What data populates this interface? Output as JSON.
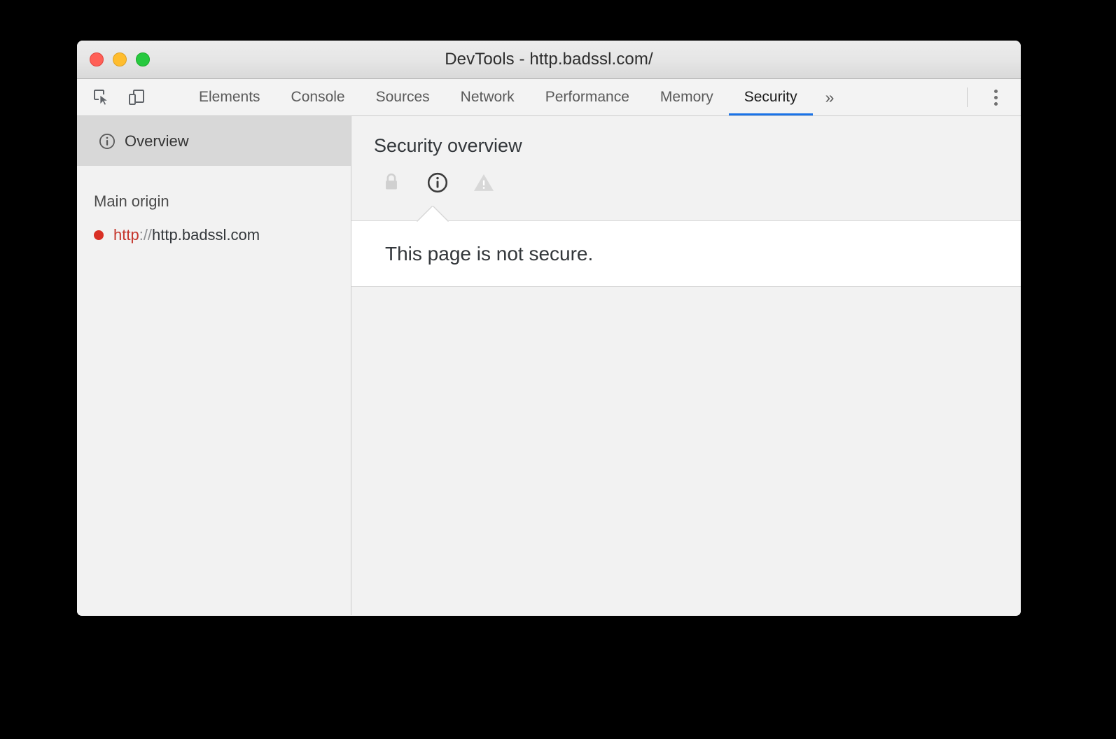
{
  "window": {
    "title": "DevTools - http.badssl.com/",
    "controls": [
      {
        "name": "close",
        "color": "#ff5f56"
      },
      {
        "name": "minimize",
        "color": "#ffbd2e"
      },
      {
        "name": "maximize",
        "color": "#27c93f"
      }
    ]
  },
  "toolbar": {
    "inspect_icon": "inspect-element-icon",
    "device_icon": "device-toolbar-icon",
    "more_tabs_label": "»",
    "kebab_icon": "more-options-icon"
  },
  "tabs": [
    {
      "label": "Elements",
      "active": false
    },
    {
      "label": "Console",
      "active": false
    },
    {
      "label": "Sources",
      "active": false
    },
    {
      "label": "Network",
      "active": false
    },
    {
      "label": "Performance",
      "active": false
    },
    {
      "label": "Memory",
      "active": false
    },
    {
      "label": "Security",
      "active": true
    }
  ],
  "active_tab": "Security",
  "accent_color": "#1a73e8",
  "sidebar": {
    "overview": {
      "label": "Overview",
      "icon": "info-circle-icon",
      "selected": true
    },
    "group_label": "Main origin",
    "origins": [
      {
        "status": "insecure",
        "status_color": "#d93025",
        "scheme": "http",
        "separator": "://",
        "host": "http.badssl.com",
        "full": "http://http.badssl.com"
      }
    ]
  },
  "main": {
    "title": "Security overview",
    "summary_icons": [
      {
        "name": "lock-icon",
        "state": "inactive",
        "color": "#d0d0d0"
      },
      {
        "name": "info-circle-icon",
        "state": "active",
        "color": "#3c3c3c"
      },
      {
        "name": "warning-triangle-icon",
        "state": "inactive",
        "color": "#d8d8d8"
      }
    ],
    "explanation": "This page is not secure."
  }
}
